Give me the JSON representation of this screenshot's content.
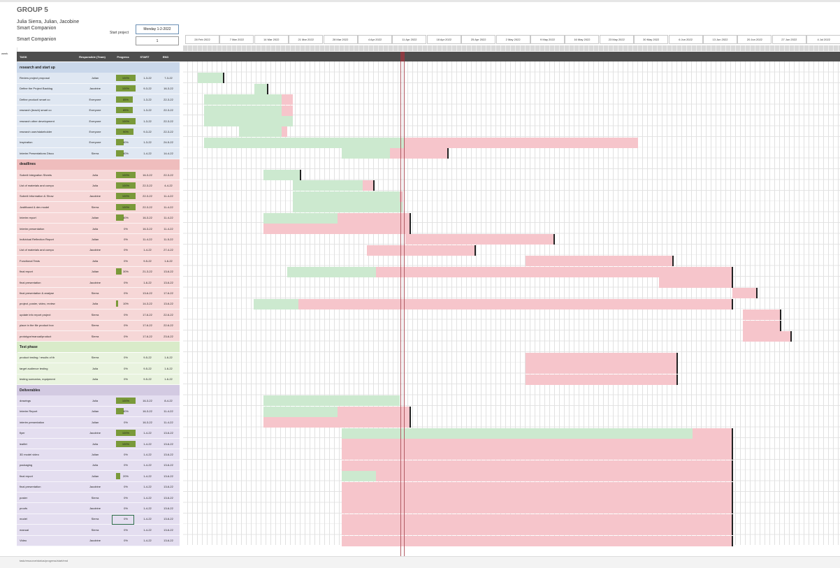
{
  "title": "GROUP 5",
  "members": "Julia Sierra, Julian, Jacobine",
  "company1": "Smart Companion",
  "company2": "Smart Companion",
  "start_label": "Start project",
  "start_value": "Monday 1-2-2022",
  "scroll_value": "1",
  "marker": "week",
  "footer_text": "task/resource/status/progress/start/end",
  "headers": {
    "task": "TASK",
    "resp": "Responsible (Team)",
    "prog": "Progress",
    "start": "START",
    "end": "END"
  },
  "weeks": [
    "28 Feb 2022",
    "7 Mar 2022",
    "14 Mar 2022",
    "21 Mar 2022",
    "28 Mar 2022",
    "4 Apr 2022",
    "11 Apr 2022",
    "18 Apr 2022",
    "25 Apr 2022",
    "2 May 2022",
    "9 May 2022",
    "16 May 2022",
    "23 May 2022",
    "30 May 2022",
    "6 Jun 2022",
    "13 Jun 2022",
    "20 Jun 2022",
    "27 Jun 2022",
    "4 Jul 2022"
  ],
  "groups": [
    {
      "name": "research and start up",
      "color": "#c9d7ea",
      "rowbg": "#dfe7f2",
      "rows": [
        {
          "task": "Review project proposal",
          "resp": "Julian",
          "prog": "100%",
          "pct": 1.0,
          "start": "1-3-22",
          "end": "7-3-22",
          "bars": [
            {
              "c": "g",
              "x0": 0.0225,
              "x1": 0.0612
            }
          ],
          "mk": 0.0612
        },
        {
          "task": "Define the Project Backlog",
          "resp": "Jacobine",
          "prog": "100%",
          "pct": 1.0,
          "start": "9-3-22",
          "end": "16-3-22",
          "bars": [
            {
              "c": "g",
              "x0": 0.1085,
              "x1": 0.1285
            }
          ],
          "mk": 0.1285
        },
        {
          "task": "Define product/ smart co",
          "resp": "Everyone",
          "prog": "85%",
          "pct": 0.85,
          "start": "1-3-22",
          "end": "22-3-22",
          "bars": [
            {
              "c": "g",
              "x0": 0.032,
              "x1": 0.15
            },
            {
              "c": "p",
              "x0": 0.15,
              "x1": 0.1665
            }
          ]
        },
        {
          "task": "research (teach) smart co",
          "resp": "Everyone",
          "prog": "85%",
          "pct": 0.85,
          "start": "1-3-22",
          "end": "22-3-22",
          "bars": [
            {
              "c": "g",
              "x0": 0.032,
              "x1": 0.15
            },
            {
              "c": "p",
              "x0": 0.15,
              "x1": 0.1665
            }
          ]
        },
        {
          "task": "research other development",
          "resp": "Everyone",
          "prog": "100%",
          "pct": 1.0,
          "start": "1-3-22",
          "end": "22-3-22",
          "bars": [
            {
              "c": "g",
              "x0": 0.032,
              "x1": 0.1665
            }
          ]
        },
        {
          "task": "research user/stakeholder",
          "resp": "Everyone",
          "prog": "90%",
          "pct": 0.9,
          "start": "9-3-22",
          "end": "22-3-22",
          "bars": [
            {
              "c": "g",
              "x0": 0.085,
              "x1": 0.15
            },
            {
              "c": "p",
              "x0": 0.15,
              "x1": 0.1585
            }
          ]
        },
        {
          "task": "Inspiration",
          "resp": "Everyone",
          "prog": "40%",
          "pct": 0.4,
          "start": "1-3-22",
          "end": "24-5-22",
          "bars": [
            {
              "c": "g",
              "x0": 0.032,
              "x1": 0.337
            },
            {
              "c": "p",
              "x0": 0.337,
              "x1": 0.6925
            }
          ]
        },
        {
          "task": "Interim Presentations Discu",
          "resp": "Sierra",
          "prog": "40%",
          "pct": 0.4,
          "start": "1-4-22",
          "end": "14-4-22",
          "bars": [
            {
              "c": "g",
              "x0": 0.242,
              "x1": 0.315
            },
            {
              "c": "p",
              "x0": 0.315,
              "x1": 0.403
            }
          ],
          "mk": 0.403
        }
      ]
    },
    {
      "name": "deadlines",
      "color": "#efbdbd",
      "rowbg": "#f6d7d7",
      "rows": [
        {
          "task": "Submit Integration Sheets",
          "resp": "Julia",
          "prog": "100%",
          "pct": 1.0,
          "start": "16-3-22",
          "end": "22-3-22",
          "bars": [
            {
              "c": "g",
              "x0": 0.122,
              "x1": 0.179
            }
          ],
          "mk": 0.179
        },
        {
          "task": "List of materials and compo",
          "resp": "Julia",
          "prog": "100%",
          "pct": 1.0,
          "start": "22-3-22",
          "end": "4-4-22",
          "bars": [
            {
              "c": "g",
              "x0": 0.167,
              "x1": 0.273
            },
            {
              "c": "p",
              "x0": 0.273,
              "x1": 0.29
            }
          ],
          "mk": 0.29
        },
        {
          "task": "Submit Information & Show",
          "resp": "Jacobine",
          "prog": "100%",
          "pct": 1.0,
          "start": "22-3-22",
          "end": "11-4-22",
          "bars": [
            {
              "c": "g",
              "x0": 0.167,
              "x1": 0.33
            },
            {
              "c": "p",
              "x0": 0.33,
              "x1": 0.334
            }
          ]
        },
        {
          "task": "Justificaed & dev model",
          "resp": "Sierra",
          "prog": "100%",
          "pct": 1.0,
          "start": "22-3-22",
          "end": "11-4-22",
          "bars": [
            {
              "c": "g",
              "x0": 0.167,
              "x1": 0.334
            }
          ]
        },
        {
          "task": "Interim report",
          "resp": "Julian",
          "prog": "40%",
          "pct": 0.4,
          "start": "16-3-22",
          "end": "11-4-22",
          "bars": [
            {
              "c": "g",
              "x0": 0.122,
              "x1": 0.235
            },
            {
              "c": "p",
              "x0": 0.235,
              "x1": 0.346
            }
          ],
          "mk": 0.346
        },
        {
          "task": "Interim presentation",
          "resp": "Julia",
          "prog": "0%",
          "pct": 0.0,
          "start": "16-3-22",
          "end": "11-4-22",
          "bars": [
            {
              "c": "p",
              "x0": 0.122,
              "x1": 0.346
            }
          ],
          "mk": 0.346
        },
        {
          "task": "Individual Reflection Report",
          "resp": "Julian",
          "prog": "0%",
          "pct": 0.0,
          "start": "11-4-22",
          "end": "11-5-22",
          "bars": [
            {
              "c": "p",
              "x0": 0.338,
              "x1": 0.565
            }
          ],
          "mk": 0.565
        },
        {
          "task": "List of materials and compo",
          "resp": "Jacobine",
          "prog": "0%",
          "pct": 0.0,
          "start": "1-4-22",
          "end": "27-4-22",
          "bars": [
            {
              "c": "p",
              "x0": 0.28,
              "x1": 0.445
            }
          ],
          "mk": 0.445
        },
        {
          "task": "Functional Tests",
          "resp": "Julia",
          "prog": "0%",
          "pct": 0.0,
          "start": "9-5-22",
          "end": "1-6-22",
          "bars": [
            {
              "c": "p",
              "x0": 0.521,
              "x1": 0.746
            }
          ],
          "mk": 0.746
        },
        {
          "task": "final report",
          "resp": "Julian",
          "prog": "30%",
          "pct": 0.3,
          "start": "21-3-22",
          "end": "13-6-22",
          "bars": [
            {
              "c": "g",
              "x0": 0.159,
              "x1": 0.294
            },
            {
              "c": "p",
              "x0": 0.294,
              "x1": 0.836
            }
          ],
          "mk": 0.836
        },
        {
          "task": "final presentation",
          "resp": "Jacobine",
          "prog": "0%",
          "pct": 0.0,
          "start": "1-6-22",
          "end": "13-6-22",
          "bars": [
            {
              "c": "p",
              "x0": 0.724,
              "x1": 0.836
            }
          ],
          "mk": 0.836
        },
        {
          "task": "final presentation & analyse",
          "resp": "Sierra",
          "prog": "0%",
          "pct": 0.0,
          "start": "13-6-22",
          "end": "17-6-22",
          "bars": [
            {
              "c": "p",
              "x0": 0.836,
              "x1": 0.873
            }
          ],
          "mk": 0.873
        },
        {
          "task": "project, poster, video, review",
          "resp": "Julia",
          "prog": "10%",
          "pct": 0.1,
          "start": "14-3-22",
          "end": "13-6-22",
          "bars": [
            {
              "c": "g",
              "x0": 0.107,
              "x1": 0.176
            },
            {
              "c": "p",
              "x0": 0.176,
              "x1": 0.836
            }
          ],
          "mk": 0.836
        },
        {
          "task": "update info report project",
          "resp": "Sierra",
          "prog": "0%",
          "pct": 0.0,
          "start": "17-6-22",
          "end": "22-6-22",
          "bars": [
            {
              "c": "p",
              "x0": 0.852,
              "x1": 0.91
            }
          ],
          "mk": 0.91
        },
        {
          "task": "place in the file product box",
          "resp": "Sierra",
          "prog": "0%",
          "pct": 0.0,
          "start": "17-6-22",
          "end": "22-6-22",
          "bars": [
            {
              "c": "p",
              "x0": 0.852,
              "x1": 0.91
            }
          ],
          "mk": 0.91
        },
        {
          "task": "prototype/manual/product",
          "resp": "Sierra",
          "prog": "0%",
          "pct": 0.0,
          "start": "17-6-22",
          "end": "23-6-22",
          "bars": [
            {
              "c": "p",
              "x0": 0.852,
              "x1": 0.926
            }
          ],
          "mk": 0.926
        }
      ]
    },
    {
      "name": "Test phase",
      "color": "#d9ebc9",
      "rowbg": "#e9f3df",
      "rows": [
        {
          "task": "product testing / results of th",
          "resp": "Sierra",
          "prog": "0%",
          "pct": 0.0,
          "start": "9-5-22",
          "end": "1-6-22",
          "bars": [
            {
              "c": "p",
              "x0": 0.521,
              "x1": 0.752
            }
          ],
          "mk": 0.752
        },
        {
          "task": "target audience testing",
          "resp": "Julia",
          "prog": "0%",
          "pct": 0.0,
          "start": "9-5-22",
          "end": "1-6-22",
          "bars": [
            {
              "c": "p",
              "x0": 0.521,
              "x1": 0.752
            }
          ],
          "mk": 0.752
        },
        {
          "task": "testing scenarios, equipment",
          "resp": "Julia",
          "prog": "0%",
          "pct": 0.0,
          "start": "9-5-22",
          "end": "1-6-22",
          "bars": [
            {
              "c": "p",
              "x0": 0.521,
              "x1": 0.752
            }
          ],
          "mk": 0.752
        }
      ]
    },
    {
      "name": "Deliverables",
      "color": "#d3cae2",
      "rowbg": "#e4def0",
      "rows": [
        {
          "task": "drawings",
          "resp": "Julia",
          "prog": "100%",
          "pct": 1.0,
          "start": "16-3-22",
          "end": "8-4-22",
          "bars": [
            {
              "c": "g",
              "x0": 0.122,
              "x1": 0.33
            }
          ]
        },
        {
          "task": "Interim Report",
          "resp": "Julian",
          "prog": "40%",
          "pct": 0.4,
          "start": "16-3-22",
          "end": "11-4-22",
          "bars": [
            {
              "c": "g",
              "x0": 0.122,
              "x1": 0.235
            },
            {
              "c": "p",
              "x0": 0.235,
              "x1": 0.346
            }
          ],
          "mk": 0.346
        },
        {
          "task": "interim presentation",
          "resp": "Julian",
          "prog": "0%",
          "pct": 0.0,
          "start": "16-3-22",
          "end": "11-4-22",
          "bars": [
            {
              "c": "p",
              "x0": 0.122,
              "x1": 0.346
            }
          ],
          "mk": 0.346
        },
        {
          "task": "flyer",
          "resp": "Jacobine",
          "prog": "100%",
          "pct": 1.0,
          "start": "1-4-22",
          "end": "13-6-22",
          "bars": [
            {
              "c": "g",
              "x0": 0.242,
              "x1": 0.776
            },
            {
              "c": "p",
              "x0": 0.776,
              "x1": 0.836
            }
          ],
          "mk": 0.836
        },
        {
          "task": "leaflet",
          "resp": "Julia",
          "prog": "100%",
          "pct": 1.0,
          "start": "1-4-22",
          "end": "13-6-22",
          "bars": [
            {
              "c": "p",
              "x0": 0.242,
              "x1": 0.836
            }
          ],
          "mk": 0.836
        },
        {
          "task": "3D model video",
          "resp": "Julian",
          "prog": "0%",
          "pct": 0.0,
          "start": "1-4-22",
          "end": "13-6-22",
          "bars": [
            {
              "c": "p",
              "x0": 0.242,
              "x1": 0.836
            }
          ],
          "mk": 0.836
        },
        {
          "task": "packaging",
          "resp": "Julia",
          "prog": "0%",
          "pct": 0.0,
          "start": "1-4-22",
          "end": "13-6-22",
          "bars": [
            {
              "c": "p",
              "x0": 0.242,
              "x1": 0.836
            }
          ],
          "mk": 0.836
        },
        {
          "task": "final report",
          "resp": "Julian",
          "prog": "20%",
          "pct": 0.2,
          "start": "1-4-22",
          "end": "13-6-22",
          "bars": [
            {
              "c": "g",
              "x0": 0.242,
              "x1": 0.294
            },
            {
              "c": "p",
              "x0": 0.294,
              "x1": 0.836
            }
          ],
          "mk": 0.836
        },
        {
          "task": "final presentation",
          "resp": "Jacobine",
          "prog": "0%",
          "pct": 0.0,
          "start": "1-4-22",
          "end": "13-6-22",
          "bars": [
            {
              "c": "p",
              "x0": 0.242,
              "x1": 0.836
            }
          ],
          "mk": 0.836
        },
        {
          "task": "poster",
          "resp": "Sierra",
          "prog": "0%",
          "pct": 0.0,
          "start": "1-4-22",
          "end": "13-6-22",
          "bars": [
            {
              "c": "p",
              "x0": 0.242,
              "x1": 0.836
            }
          ],
          "mk": 0.836
        },
        {
          "task": "proofs",
          "resp": "Jacobine",
          "prog": "0%",
          "pct": 0.0,
          "start": "1-4-22",
          "end": "13-6-22",
          "bars": [
            {
              "c": "p",
              "x0": 0.242,
              "x1": 0.836
            }
          ],
          "mk": 0.836
        },
        {
          "task": "model",
          "resp": "Sierra",
          "prog": "0%",
          "pct": 0.0,
          "start": "1-4-22",
          "end": "13-6-22",
          "bars": [
            {
              "c": "p",
              "x0": 0.242,
              "x1": 0.836
            }
          ],
          "mk": 0.836
        },
        {
          "task": "manual",
          "resp": "Sierra",
          "prog": "0%",
          "pct": 0.0,
          "start": "1-4-22",
          "end": "13-6-22",
          "bars": [
            {
              "c": "p",
              "x0": 0.242,
              "x1": 0.836
            }
          ],
          "mk": 0.836
        },
        {
          "task": "Video",
          "resp": "Jacobine",
          "prog": "0%",
          "pct": 0.0,
          "start": "1-4-22",
          "end": "13-6-22",
          "bars": [
            {
              "c": "p",
              "x0": 0.242,
              "x1": 0.836
            }
          ],
          "mk": 0.836
        }
      ]
    }
  ]
}
